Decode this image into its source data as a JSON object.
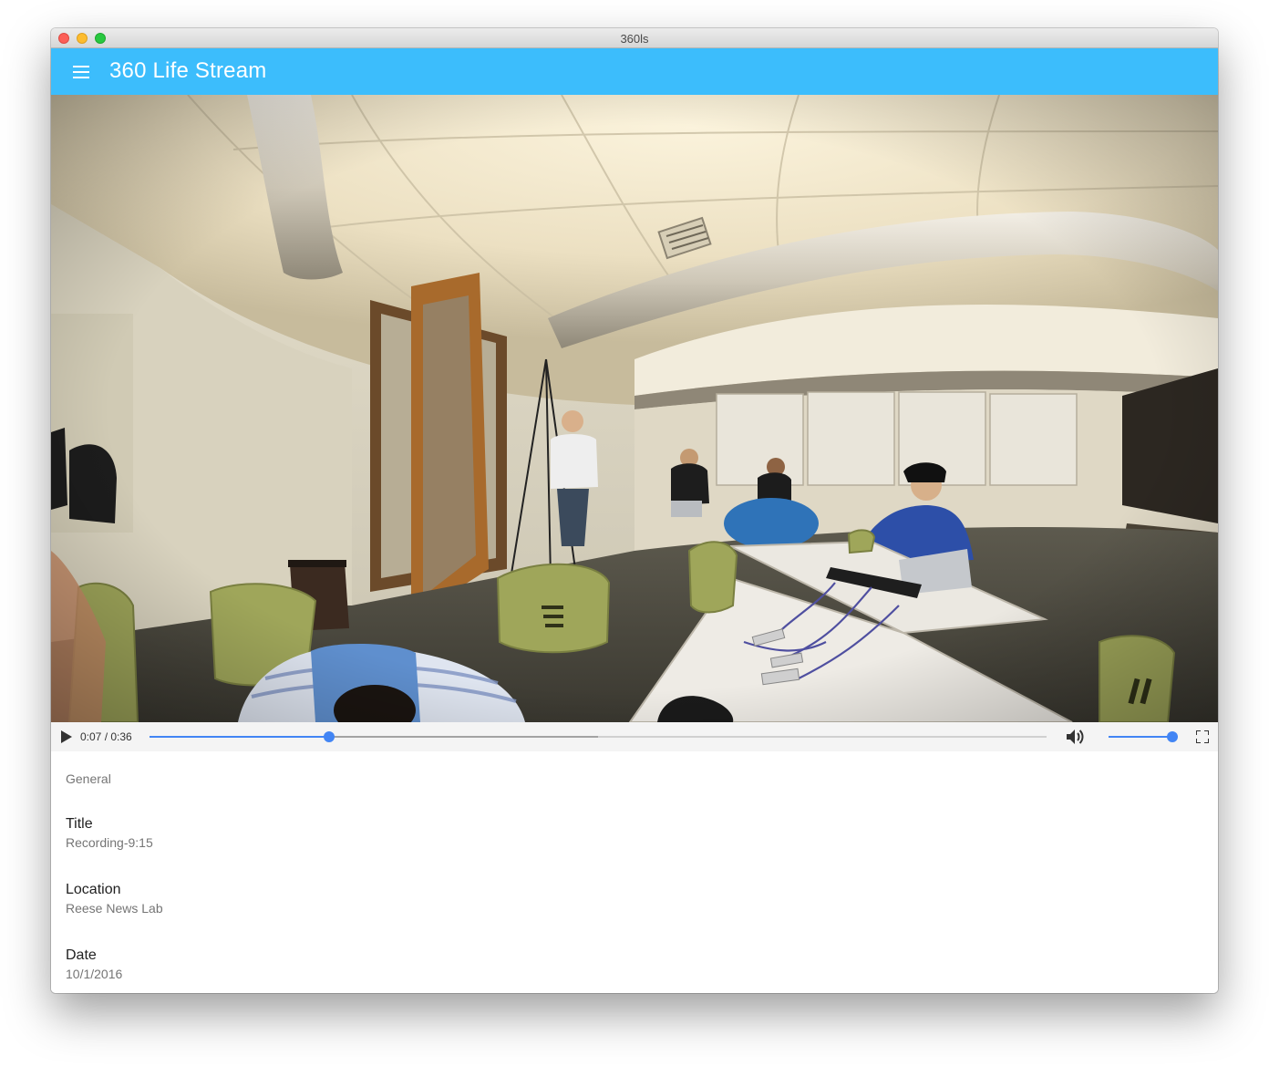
{
  "window": {
    "title": "360ls"
  },
  "appbar": {
    "title": "360 Life Stream",
    "menu_icon": "menu-icon"
  },
  "player": {
    "time_display": "0:07 / 0:36",
    "progress_fraction": 0.2,
    "buffered_fraction": 0.5,
    "volume_fraction": 1.0,
    "accent_color": "#4285f4",
    "icons": [
      "play-icon",
      "volume-icon",
      "fullscreen-icon"
    ]
  },
  "details": {
    "section_title": "General",
    "items": [
      {
        "label": "Title",
        "value": "Recording-9:15"
      },
      {
        "label": "Location",
        "value": "Reese News Lab"
      },
      {
        "label": "Date",
        "value": "10/1/2016"
      }
    ]
  },
  "colors": {
    "appbar": "#3cbdfc",
    "subheader_text": "#757575"
  }
}
